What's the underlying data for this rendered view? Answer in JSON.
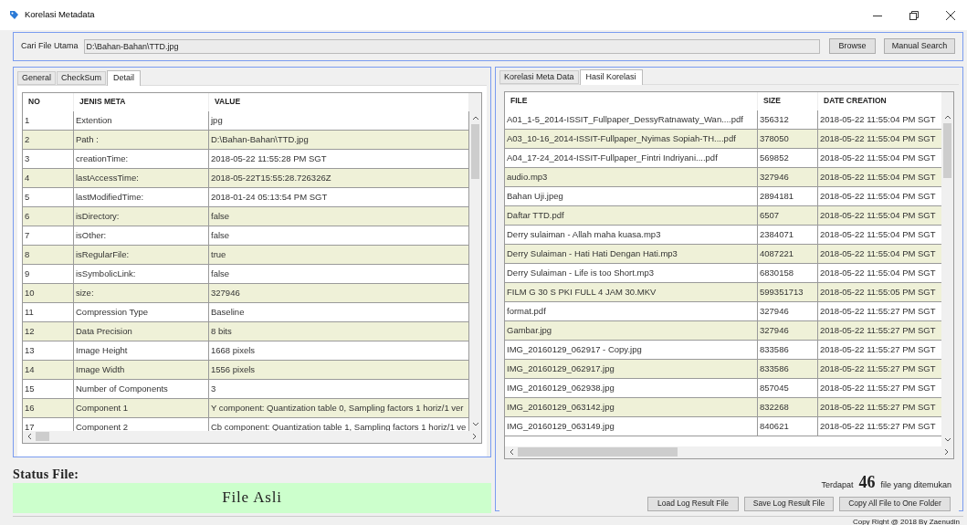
{
  "window": {
    "title": "Korelasi Metadata"
  },
  "search": {
    "label": "Cari File Utama",
    "value": "D:\\Bahan-Bahan\\TTD.jpg",
    "buttons": [
      "Browse",
      "Manual Search"
    ]
  },
  "left_tabs": [
    {
      "label": "General",
      "selected": false
    },
    {
      "label": "CheckSum",
      "selected": false
    },
    {
      "label": "Detail",
      "selected": true
    }
  ],
  "meta_table": {
    "columns": [
      "NO",
      "JENIS META",
      "VALUE"
    ],
    "rows": [
      [
        "1",
        "Extention",
        "jpg"
      ],
      [
        "2",
        "Path :",
        "D:\\Bahan-Bahan\\TTD.jpg"
      ],
      [
        "3",
        "creationTime:",
        "2018-05-22 11:55:28 PM SGT"
      ],
      [
        "4",
        "lastAccessTime:",
        "2018-05-22T15:55:28.726326Z"
      ],
      [
        "5",
        "lastModifiedTime:",
        "2018-01-24 05:13:54 PM SGT"
      ],
      [
        "6",
        "isDirectory:",
        "false"
      ],
      [
        "7",
        "isOther:",
        "false"
      ],
      [
        "8",
        "isRegularFile:",
        "true"
      ],
      [
        "9",
        "isSymbolicLink:",
        "false"
      ],
      [
        "10",
        "size:",
        "327946"
      ],
      [
        "11",
        "Compression Type",
        "Baseline"
      ],
      [
        "12",
        "Data Precision",
        "8 bits"
      ],
      [
        "13",
        "Image Height",
        "1668 pixels"
      ],
      [
        "14",
        "Image Width",
        "1556 pixels"
      ],
      [
        "15",
        "Number of Components",
        "3"
      ],
      [
        "16",
        "Component 1",
        "Y component: Quantization table 0, Sampling factors 1 horiz/1 ver"
      ],
      [
        "17",
        "Component 2",
        "Cb component: Quantization table 1, Sampling factors 1 horiz/1 ve"
      ]
    ]
  },
  "status": {
    "label": "Status File:",
    "value": "File Asli"
  },
  "right_tabs": [
    {
      "label": "Korelasi Meta Data",
      "selected": false
    },
    {
      "label": "Hasil Korelasi",
      "selected": true
    }
  ],
  "result_table": {
    "columns": [
      "FILE",
      "SIZE",
      "DATE CREATION"
    ],
    "rows": [
      [
        "A01_1-5_2014-ISSIT_Fullpaper_DessyRatnawaty_Wan....pdf",
        "356312",
        "2018-05-22 11:55:04 PM SGT"
      ],
      [
        "A03_10-16_2014-ISSIT-Fullpaper_Nyimas Sopiah-TH....pdf",
        "378050",
        "2018-05-22 11:55:04 PM SGT"
      ],
      [
        "A04_17-24_2014-ISSIT-Fullpaper_Fintri Indriyani....pdf",
        "569852",
        "2018-05-22 11:55:04 PM SGT"
      ],
      [
        "audio.mp3",
        "327946",
        "2018-05-22 11:55:04 PM SGT"
      ],
      [
        "Bahan Uji.jpeg",
        "2894181",
        "2018-05-22 11:55:04 PM SGT"
      ],
      [
        "Daftar TTD.pdf",
        "6507",
        "2018-05-22 11:55:04 PM SGT"
      ],
      [
        "Derry sulaiman - Allah maha kuasa.mp3",
        "2384071",
        "2018-05-22 11:55:04 PM SGT"
      ],
      [
        "Derry Sulaiman - Hati Hati Dengan Hati.mp3",
        "4087221",
        "2018-05-22 11:55:04 PM SGT"
      ],
      [
        "Derry Sulaiman - Life is too Short.mp3",
        "6830158",
        "2018-05-22 11:55:04 PM SGT"
      ],
      [
        "FILM G 30 S PKI FULL 4 JAM 30.MKV",
        "599351713",
        "2018-05-22 11:55:05 PM SGT"
      ],
      [
        "format.pdf",
        "327946",
        "2018-05-22 11:55:27 PM SGT"
      ],
      [
        "Gambar.jpg",
        "327946",
        "2018-05-22 11:55:27 PM SGT"
      ],
      [
        "IMG_20160129_062917 - Copy.jpg",
        "833586",
        "2018-05-22 11:55:27 PM SGT"
      ],
      [
        "IMG_20160129_062917.jpg",
        "833586",
        "2018-05-22 11:55:27 PM SGT"
      ],
      [
        "IMG_20160129_062938.jpg",
        "857045",
        "2018-05-22 11:55:27 PM SGT"
      ],
      [
        "IMG_20160129_063142.jpg",
        "832268",
        "2018-05-22 11:55:27 PM SGT"
      ],
      [
        "IMG_20160129_063149.jpg",
        "840621",
        "2018-05-22 11:55:27 PM SGT"
      ]
    ]
  },
  "count": {
    "prefix": "Terdapat",
    "number": "46",
    "suffix": "file yang ditemukan"
  },
  "actions": [
    "Load Log Result File",
    "Save Log Result File",
    "Copy All File to One Folder"
  ],
  "footer": "Copy Right @ 2018 By Zaenudin"
}
